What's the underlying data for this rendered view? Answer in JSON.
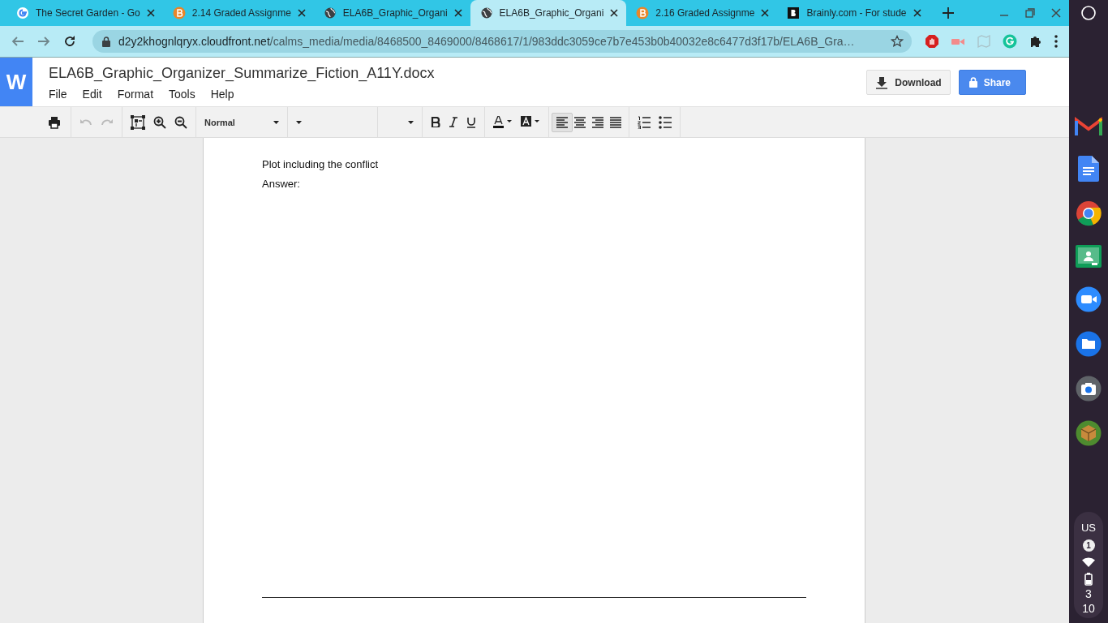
{
  "browser": {
    "tabs": [
      {
        "title": "The Secret Garden - Go",
        "kind": "google",
        "selected": false
      },
      {
        "title": "2.14 Graded Assignme",
        "kind": "bcircle",
        "selected": false
      },
      {
        "title": "ELA6B_Graphic_Organi",
        "kind": "globe",
        "selected": false
      },
      {
        "title": "ELA6B_Graphic_Organi",
        "kind": "globe",
        "selected": true
      },
      {
        "title": "2.16 Graded Assignme",
        "kind": "bcircle",
        "selected": false
      },
      {
        "title": "Brainly.com - For stude",
        "kind": "bsquare",
        "selected": false
      }
    ],
    "url_host": "d2y2khognlqryx.cloudfront.net",
    "url_path": "/calms_media/media/8468500_8469000/8468617/1/983ddc3059ce7b7e453b0b40032e8c6477d3f17b/ELA6B_Gra…"
  },
  "app": {
    "logo": "W",
    "file_name": "ELA6B_Graphic_Organizer_Summarize_Fiction_A11Y.docx",
    "menu": [
      "File",
      "Edit",
      "Format",
      "Tools",
      "Help"
    ],
    "download": "Download",
    "share": "Share",
    "toolbar": {
      "style": "Normal",
      "align": [
        {
          "kind": "left",
          "selected": true
        },
        {
          "kind": "center",
          "selected": false
        },
        {
          "kind": "right",
          "selected": false
        },
        {
          "kind": "justify",
          "selected": false
        }
      ]
    }
  },
  "document": {
    "lines": [
      "Plot including the conflict",
      "Answer:"
    ]
  },
  "shelf": {
    "lang": "US",
    "badge": "1",
    "time_hour": "3",
    "time_min": "10"
  }
}
